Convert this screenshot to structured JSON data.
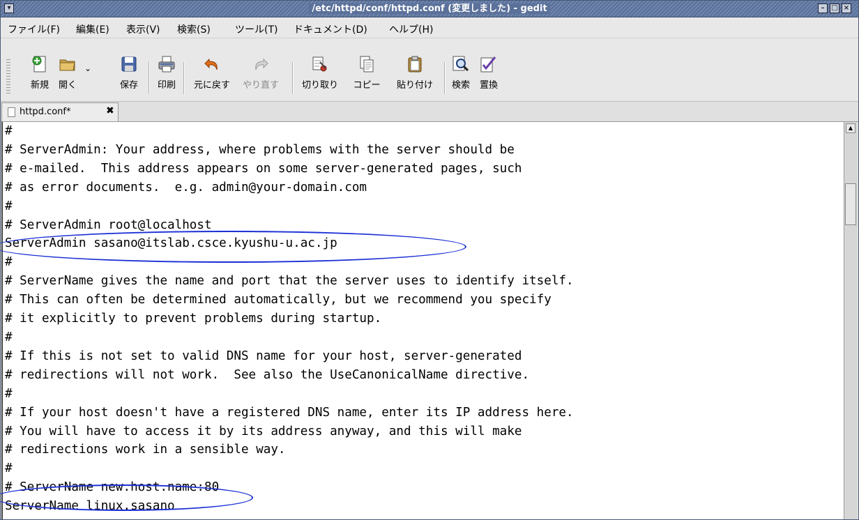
{
  "window": {
    "title": "/etc/httpd/conf/httpd.conf (変更しました) - gedit"
  },
  "menubar": {
    "items": [
      "ファイル(F)",
      "編集(E)",
      "表示(V)",
      "検索(S)",
      "ツール(T)",
      "ドキュメント(D)",
      "ヘルプ(H)"
    ]
  },
  "toolbar": {
    "new": "新規",
    "open": "開く",
    "save": "保存",
    "print": "印刷",
    "undo": "元に戻す",
    "redo": "やり直す",
    "cut": "切り取り",
    "copy": "コピー",
    "paste": "貼り付け",
    "find": "検索",
    "replace": "置換"
  },
  "tab": {
    "label": "httpd.conf*"
  },
  "editor": {
    "lines": [
      "#",
      "# ServerAdmin: Your address, where problems with the server should be",
      "# e-mailed.  This address appears on some server-generated pages, such",
      "# as error documents.  e.g. admin@your-domain.com",
      "#",
      "# ServerAdmin root@localhost",
      "ServerAdmin sasano@itslab.csce.kyushu-u.ac.jp",
      "#",
      "# ServerName gives the name and port that the server uses to identify itself.",
      "# This can often be determined automatically, but we recommend you specify",
      "# it explicitly to prevent problems during startup.",
      "#",
      "# If this is not set to valid DNS name for your host, server-generated",
      "# redirections will not work.  See also the UseCanonicalName directive.",
      "#",
      "# If your host doesn't have a registered DNS name, enter its IP address here.",
      "# You will have to access it by its address anyway, and this will make",
      "# redirections work in a sensible way.",
      "#",
      "# ServerName new.host.name:80",
      "ServerName linux.sasano",
      "#"
    ]
  },
  "colors": {
    "annotation": "#1a2fd6",
    "titlebar": "#6f86ad"
  }
}
